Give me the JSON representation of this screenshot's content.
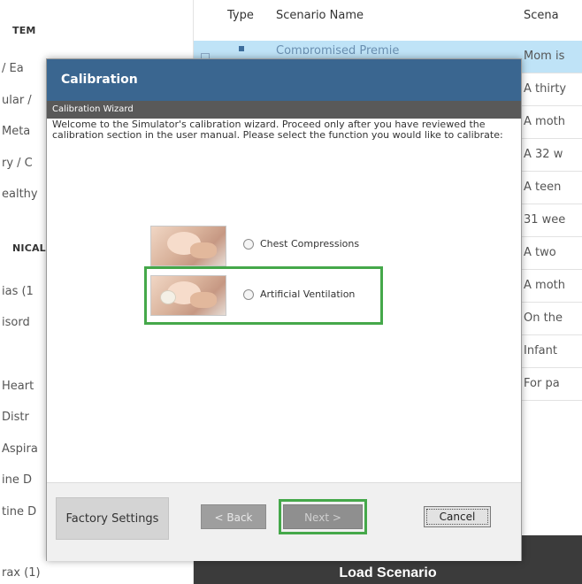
{
  "sidebar": {
    "headings": [
      "TEM",
      "NICAL"
    ],
    "items": [
      "/ Ea",
      "ular /",
      "Meta",
      "ry / C",
      "ealthy",
      "ias (1",
      "isord",
      "Heart",
      "Distr",
      "Aspira",
      "ine D",
      "tine D",
      "rax (1)"
    ]
  },
  "table": {
    "headers": {
      "type": "Type",
      "name": "Scenario Name",
      "desc": "Scena"
    },
    "selected_row_name": "Compromised Premie",
    "descriptions": [
      "Mom is",
      "A thirty",
      "A moth",
      "A 32 w",
      "A teen",
      "31 wee",
      "A two",
      "A moth",
      "On the",
      "Infant",
      "For pa"
    ]
  },
  "load": {
    "label": "Load Scenario"
  },
  "dialog": {
    "title": "Calibration",
    "subtitle": "Calibration Wizard",
    "intro": "Welcome to the Simulator's calibration wizard.  Proceed only after you have reviewed the calibration section in the user manual.  Please select the function you would like to calibrate:",
    "options": [
      {
        "label": "Chest Compressions"
      },
      {
        "label": "Artificial Ventilation"
      }
    ],
    "buttons": {
      "factory": "Factory Settings",
      "back": "< Back",
      "next": "Next >",
      "cancel": "Cancel"
    }
  },
  "colors": {
    "title_bar": "#3a6690",
    "sub_bar": "#595959",
    "highlight": "#45a84a",
    "selected_row": "#bfe3f7",
    "load_bar": "#3b3b3b"
  }
}
